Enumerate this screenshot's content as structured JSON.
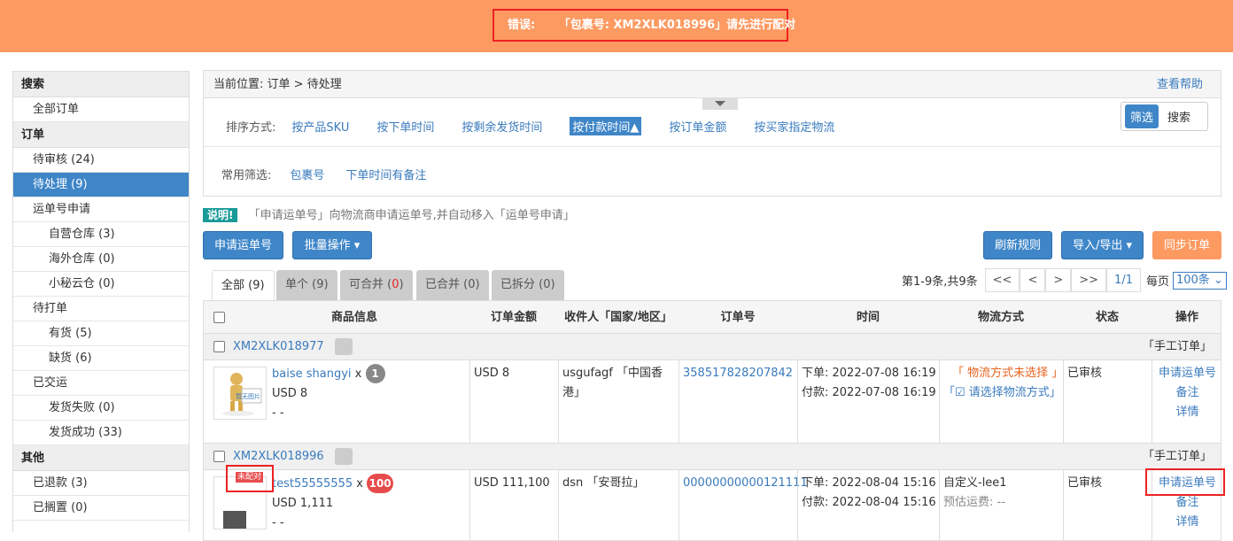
{
  "banner": {
    "error_label": "错误:",
    "error_message": "「包裹号: XM2XLK018996」请先进行配对"
  },
  "sidebar": {
    "search_head": "搜索",
    "all_orders": "全部订单",
    "orders_head": "订单",
    "items": [
      {
        "label": "待审核 (24)"
      },
      {
        "label": "待处理 (9)"
      },
      {
        "label": "运单号申请"
      },
      {
        "label": "自营仓库 (3)"
      },
      {
        "label": "海外仓库 (0)"
      },
      {
        "label": "小秘云仓 (0)"
      },
      {
        "label": "待打单"
      },
      {
        "label": "有货 (5)"
      },
      {
        "label": "缺货 (6)"
      },
      {
        "label": "已交运"
      },
      {
        "label": "发货失败 (0)"
      },
      {
        "label": "发货成功 (33)"
      }
    ],
    "other_head": "其他",
    "other_items": [
      {
        "label": "已退款 (3)"
      },
      {
        "label": "已搁置 (0)"
      }
    ]
  },
  "breadcrumb": {
    "text": "当前位置: 订单 > 待处理",
    "help": "查看帮助"
  },
  "sort": {
    "label": "排序方式:",
    "options": [
      "按产品SKU",
      "按下单时间",
      "按剩余发货时间",
      "按付款时间▲",
      "按订单金额",
      "按买家指定物流"
    ]
  },
  "common_filter": {
    "label": "常用筛选:",
    "options": [
      "包裹号",
      "下单时间有备注"
    ]
  },
  "toggle": {
    "filter": "筛选",
    "search": "搜索"
  },
  "info": {
    "tag": "说明!",
    "text": "「申请运单号」向物流商申请运单号,并自动移入「运单号申请」"
  },
  "toolbar": {
    "apply_tracking": "申请运单号",
    "batch": "批量操作 ▾",
    "refresh_rules": "刷新规则",
    "import_export": "导入/导出 ▾",
    "sync": "同步订单"
  },
  "tabs": {
    "all": "全部 (9)",
    "single": "单个 (9)",
    "mergeable_pre": "可合并 (",
    "mergeable_num": "0",
    "mergeable_post": ")",
    "merged": "已合并 (0)",
    "split": "已拆分 (0)"
  },
  "pager": {
    "summary": "第1-9条,共9条",
    "first": "<<",
    "prev": "<",
    "next": ">",
    "last": ">>",
    "page": "1/1",
    "per_page_label": "每页",
    "per_page": "100条"
  },
  "table": {
    "headers": [
      "商品信息",
      "订单金额",
      "收件人「国家/地区」",
      "订单号",
      "时间",
      "物流方式",
      "状态",
      "操作"
    ],
    "orders": [
      {
        "package": "XM2XLK018977",
        "manual": "「手工订单」",
        "thumb_text": "暂无图片",
        "product": "baise shangyi",
        "x": "x",
        "qty": "1",
        "price": "USD 8",
        "dash": "- -",
        "amount": "USD 8",
        "recipient": "usgufagf 「中国香港」",
        "order_no": "358517828207842",
        "placed": "下单: 2022-07-08 16:19",
        "paid": "付款: 2022-07-08 16:19",
        "logistics_warn": "「 物流方式未选择 」",
        "logistics_select": "「☑ 请选择物流方式」",
        "status": "已审核",
        "actions": [
          "申请运单号",
          "备注",
          "详情"
        ]
      },
      {
        "package": "XM2XLK018996",
        "manual": "「手工订单」",
        "badge": "未配对",
        "product": "test55555555",
        "x": "x",
        "qty": "100",
        "price": "USD 1,111",
        "dash": "- -",
        "amount": "USD 111,100",
        "recipient": "dsn 「安哥拉」",
        "order_no": "00000000000121111",
        "placed": "下单: 2022-08-04 15:16",
        "paid": "付款: 2022-08-04 15:16",
        "logistics": "自定义-lee1",
        "freight": "预估运费: --",
        "status": "已审核",
        "actions": [
          "申请运单号",
          "备注",
          "详情"
        ]
      }
    ]
  }
}
